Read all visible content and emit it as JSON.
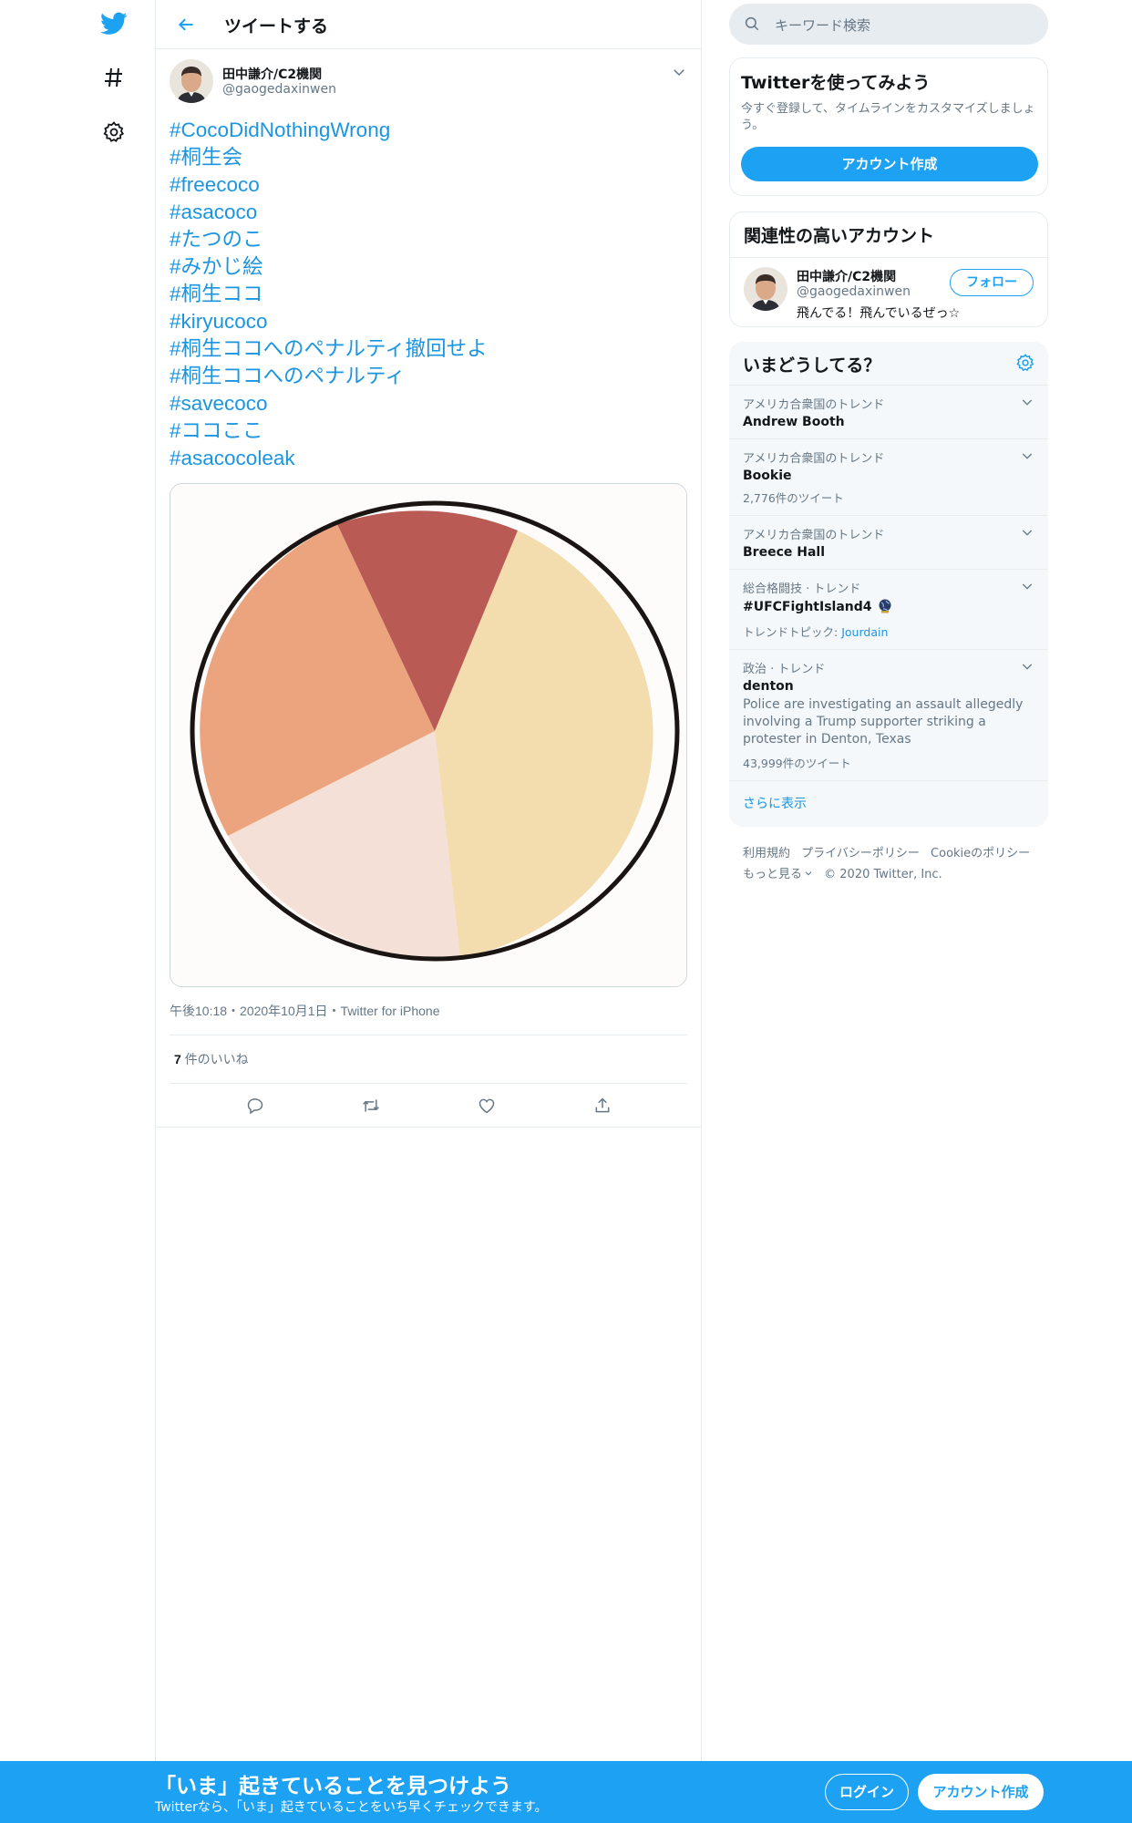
{
  "header": {
    "title": "ツイートする"
  },
  "tweet": {
    "author_name": "田中謙介/C2機関",
    "author_handle": "@gaogedaxinwen",
    "hashtags": [
      "#CocoDidNothingWrong",
      "#桐生会",
      "#freecoco",
      "#asacoco",
      "#たつのこ",
      "#みかじ絵",
      "#桐生ココ",
      "#kiryucoco",
      "#桐生ココへのペナルティ撤回せよ",
      "#桐生ココへのペナルティ",
      "#savecoco",
      "#ココここ",
      "#asacocoleak"
    ],
    "meta": "午後10:18・2020年10月1日・Twitter for iPhone",
    "likes_count": "7",
    "likes_label": "件のいいね"
  },
  "search": {
    "placeholder": "キーワード検索"
  },
  "signup_card": {
    "title": "Twitterを使ってみよう",
    "description": "今すぐ登録して、タイムラインをカスタマイズしましょう。",
    "button": "アカウント作成"
  },
  "related": {
    "title": "関連性の高いアカウント",
    "name": "田中謙介/C2機関",
    "handle": "@gaogedaxinwen",
    "bio": "飛んでる！飛んでいるぜっ☆",
    "follow": "フォロー"
  },
  "trends": {
    "title": "いまどうしてる？",
    "items": [
      {
        "context": "アメリカ合衆国のトレンド",
        "name": "Andrew Booth"
      },
      {
        "context": "アメリカ合衆国のトレンド",
        "name": "Bookie",
        "count": "2,776件のツイート"
      },
      {
        "context": "アメリカ合衆国のトレンド",
        "name": "Breece Hall"
      },
      {
        "context": "総合格闘技 · トレンド",
        "name": "#UFCFightIsland4",
        "topic_label": "トレンドトピック:",
        "topic_value": "Jourdain"
      },
      {
        "context": "政治 · トレンド",
        "name": "denton",
        "description": "Police are investigating an assault allegedly involving a Trump supporter striking a protester in Denton, Texas",
        "count": "43,999件のツイート"
      }
    ],
    "show_more": "さらに表示"
  },
  "footer": {
    "terms": "利用規約",
    "privacy": "プライバシーポリシー",
    "cookie": "Cookieのポリシー",
    "more": "もっと見る",
    "copyright": "© 2020 Twitter, Inc."
  },
  "bottom_bar": {
    "title": "「いま」起きていることを見つけよう",
    "subtitle": "Twitterなら、「いま」起きていることをいち早くチェックできます。",
    "login": "ログイン",
    "signup": "アカウント作成"
  },
  "colors": {
    "accent": "#1da1f2",
    "link": "#1b95e0",
    "pie_peach": "#f3dcae",
    "pie_pink": "#f4e0d6",
    "pie_orange": "#eba47d",
    "pie_red": "#b95a54"
  },
  "icons": {
    "nav": [
      "twitter-bird-icon",
      "hashtag-icon",
      "gear-icon"
    ],
    "actions": [
      "reply-icon",
      "retweet-icon",
      "like-icon",
      "share-icon"
    ]
  }
}
